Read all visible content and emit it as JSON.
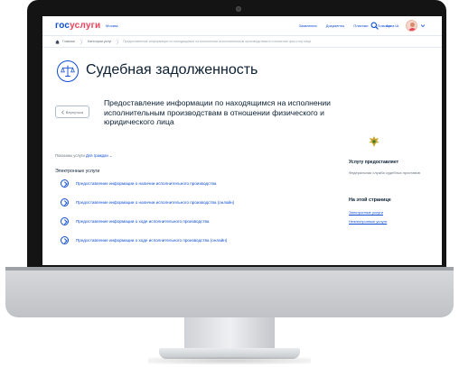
{
  "colors": {
    "accent": "#0d4cd3",
    "brand_red": "#ee3f58",
    "text_dark": "#0b1f33",
    "text_muted": "#66727f"
  },
  "header": {
    "logo_part1": "гос",
    "logo_part2": "услуги",
    "city": "Москва",
    "nav": [
      "Заявления",
      "Документы",
      "Платежи",
      "Помощь"
    ],
    "user_name": "Анна Ш."
  },
  "breadcrumbs": {
    "home": "Главная",
    "category": "Категории услуг",
    "current": "Предоставление информации по находящимся на исполнении исполнительным производствам в отношении физ и юр лица"
  },
  "page": {
    "title": "Судебная задолженность",
    "back_label": "Вернуться",
    "service_title": "Предоставление информации по находящимся на исполнении исполнительным производствам в отношении физического и юридического лица",
    "show_for_prefix": "Показаны услуги",
    "show_for_value": "Для граждан",
    "section_title": "Электронные услуги",
    "services": [
      "Предоставление информации о наличии исполнительного производства",
      "Предоставление информации о наличии исполнительного производства (онлайн)",
      "Предоставление информации о ходе исполнительного производства",
      "Предоставление информации о ходе исполнительного производства (онлайн)"
    ]
  },
  "aside": {
    "provided_by_heading": "Услугу предоставляет",
    "provider": "Федеральная служба судебных приставов",
    "on_page_heading": "На этой странице",
    "links": [
      "Электронные услуги",
      "Неэлектронные услуги"
    ]
  }
}
